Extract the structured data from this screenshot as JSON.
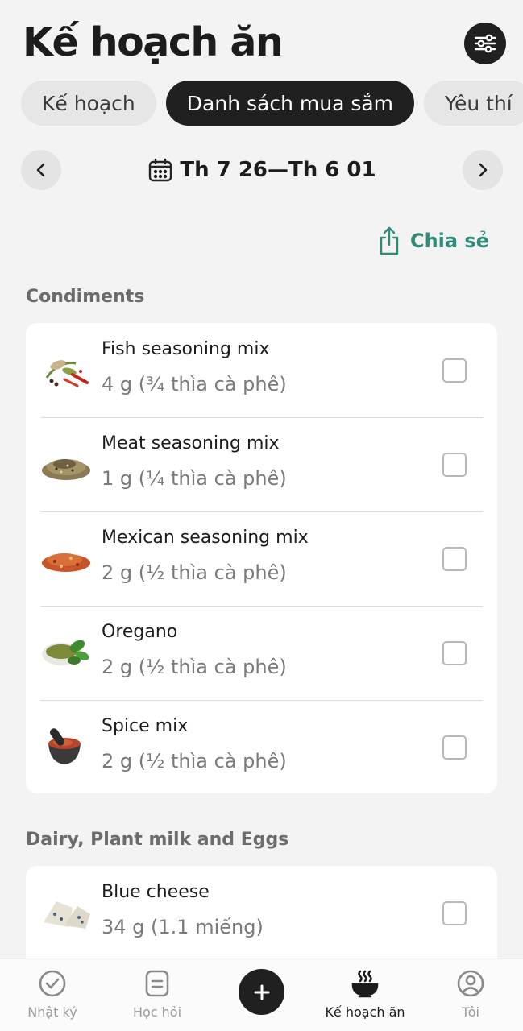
{
  "header": {
    "title": "Kế hoạch ăn"
  },
  "tabs": [
    {
      "label": "Kế hoạch"
    },
    {
      "label": "Danh sách mua sắm"
    },
    {
      "label": "Yêu thí"
    }
  ],
  "week": {
    "range": "Th 7 26—Th 6 01"
  },
  "share": {
    "label": "Chia sẻ"
  },
  "sections": [
    {
      "title": "Condiments",
      "items": [
        {
          "name": "Fish seasoning mix",
          "qty": "4 g (¾ thìa cà phê)",
          "checked": false
        },
        {
          "name": "Meat seasoning mix",
          "qty": "1 g (¼ thìa cà phê)",
          "checked": false
        },
        {
          "name": "Mexican seasoning mix",
          "qty": "2 g (½ thìa cà phê)",
          "checked": false
        },
        {
          "name": "Oregano",
          "qty": "2 g (½ thìa cà phê)",
          "checked": false
        },
        {
          "name": "Spice mix",
          "qty": "2 g (½ thìa cà phê)",
          "checked": false
        }
      ]
    },
    {
      "title": "Dairy, Plant milk and Eggs",
      "items": [
        {
          "name": "Blue cheese",
          "qty": "34 g (1.1 miếng)",
          "checked": false
        }
      ]
    }
  ],
  "bottom_nav": [
    {
      "label": "Nhật ký",
      "icon": "check-circle-icon",
      "active": false
    },
    {
      "label": "Học hỏi",
      "icon": "document-icon",
      "active": false
    },
    {
      "label": "",
      "icon": "plus-icon",
      "active": false
    },
    {
      "label": "Kế hoạch ăn",
      "icon": "bowl-icon",
      "active": true
    },
    {
      "label": "Tôi",
      "icon": "user-icon",
      "active": false
    }
  ],
  "colors": {
    "accent": "#2f8a78",
    "dark": "#202020",
    "background": "#f3f3f3"
  }
}
